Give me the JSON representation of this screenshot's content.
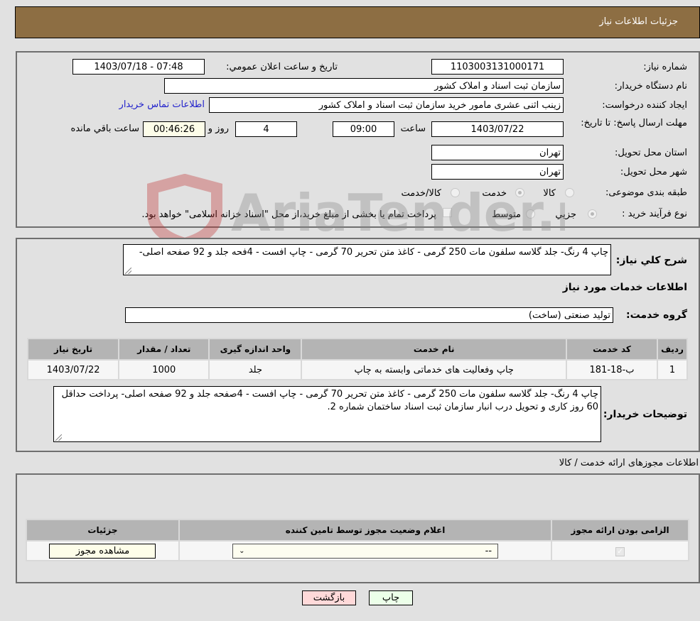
{
  "header": {
    "title": "جزئیات اطلاعات نیاز"
  },
  "details": {
    "need_number_label": "شماره نیاز:",
    "need_number": "1103003131000171",
    "announce_label": "تاريخ و ساعت اعلان عمومي:",
    "announce_value": "1403/07/18 - 07:48",
    "buyer_org_label": "نام دستگاه خریدار:",
    "buyer_org": "سازمان ثبت اسناد و املاک کشور",
    "creator_label": "ایجاد کننده درخواست:",
    "creator": "زینب اثنی عشری مامور خرید سازمان ثبت اسناد و املاک کشور",
    "contact_link": "اطلاعات تماس خریدار",
    "deadline_label": "مهلت ارسال پاسخ: تا تاریخ:",
    "deadline_date": "1403/07/22",
    "time_label": "ساعت",
    "deadline_time": "09:00",
    "days_value": "4",
    "days_label": "روز و",
    "remaining_time": "00:46:26",
    "remaining_label": "ساعت باقي مانده",
    "province_label": "استان محل تحویل:",
    "province": "تهران",
    "city_label": "شهر محل تحویل:",
    "city": "تهران",
    "category_label": "طبقه بندی موضوعی:",
    "category_options": [
      "کالا",
      "خدمت",
      "کالا/خدمت"
    ],
    "category_selected": "خدمت",
    "process_label": "نوع فرآیند خرید :",
    "process_options": [
      "جزيي",
      "متوسط"
    ],
    "process_selected": "جزيي",
    "treasury_note": "پرداخت تمام یا بخشی از مبلغ خرید،از محل \"اسناد خزانه اسلامی\" خواهد بود."
  },
  "description": {
    "label": "شرح کلي نياز:",
    "text": "چاپ 4 رنگ- جلد گلاسه سلفون مات 250 گرمی - کاغذ متن تحریر 70 گرمی - چاپ افست - 4فحه جلد و 92 صفحه اصلی-",
    "services_heading": "اطلاعات خدمات مورد نیاز",
    "service_group_label": "گروه خدمت:",
    "service_group": "تولید صنعتی (ساخت)"
  },
  "services_table": {
    "headers": [
      "ردیف",
      "کد خدمت",
      "نام خدمت",
      "واحد اندازه گیری",
      "تعداد / مقدار",
      "تاریخ نیاز"
    ],
    "rows": [
      [
        "1",
        "ب-18-181",
        "چاپ وفعالیت های خدماتی وابسته به چاپ",
        "جلد",
        "1000",
        "1403/07/22"
      ]
    ]
  },
  "buyer_notes": {
    "label": "توضیحات خریدار:",
    "text": "چاپ 4 رنگ- جلد گلاسه سلفون مات 250 گرمی - کاغذ متن تحریر 70 گرمی - چاپ افست - 4صفحه جلد و 92 صفحه اصلی- پرداخت حداقل 60 روز کاری و تحویل درب انبار سازمان ثبت اسناد ساختمان شماره 2."
  },
  "permits": {
    "heading": "اطلاعات مجوزهای ارائه خدمت / کالا",
    "headers": [
      "الزامی بودن ارائه مجوز",
      "اعلام وضعیت مجوز توسط تامین کننده",
      "جزئیات"
    ],
    "required_checked": true,
    "status_select_value": "--",
    "view_button": "مشاهده مجوز"
  },
  "buttons": {
    "print": "چاپ",
    "back": "بازگشت"
  },
  "watermark": {
    "text": "AriaTender.neT"
  },
  "colors": {
    "header_bg": "#8d6e43",
    "print_bg": "#ecffe9",
    "back_bg": "#ffd9d9",
    "link": "#2222cc"
  }
}
